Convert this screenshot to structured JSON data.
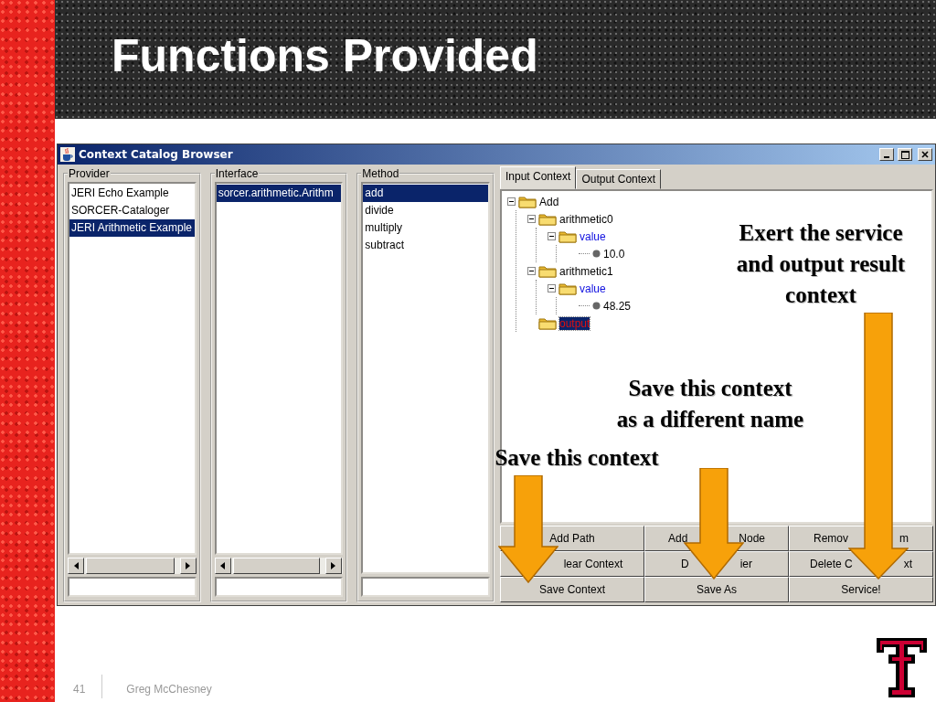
{
  "slide": {
    "title": "Functions Provided",
    "page_number": "41",
    "author": "Greg McChesney"
  },
  "window": {
    "title": "Context Catalog Browser"
  },
  "panels": [
    {
      "title": "Provider",
      "horizontal_scrollbar": true,
      "items": [
        {
          "label": "JERI Echo Example",
          "selected": false
        },
        {
          "label": "SORCER-Cataloger",
          "selected": false
        },
        {
          "label": "JERI Arithmetic Example",
          "selected": true
        }
      ]
    },
    {
      "title": "Interface",
      "horizontal_scrollbar": true,
      "items": [
        {
          "label": "sorcer.arithmetic.Arithm",
          "selected": true
        }
      ]
    },
    {
      "title": "Method",
      "horizontal_scrollbar": false,
      "items": [
        {
          "label": "add",
          "selected": true
        },
        {
          "label": "divide",
          "selected": false
        },
        {
          "label": "multiply",
          "selected": false
        },
        {
          "label": "subtract",
          "selected": false
        }
      ]
    }
  ],
  "tabs": [
    {
      "label": "Input Context",
      "selected": true
    },
    {
      "label": "Output Context",
      "selected": false
    }
  ],
  "tree": [
    {
      "label": "Add",
      "kind": "folder",
      "expanded": true,
      "selected": false,
      "children": [
        {
          "label": "arithmetic0",
          "kind": "folder",
          "expanded": true,
          "selected": false,
          "children": [
            {
              "label": "value",
              "kind": "path",
              "expanded": true,
              "selected": false,
              "children": [
                {
                  "label": "10.0",
                  "kind": "leaf",
                  "selected": false
                }
              ]
            }
          ]
        },
        {
          "label": "arithmetic1",
          "kind": "folder",
          "expanded": true,
          "selected": false,
          "children": [
            {
              "label": "value",
              "kind": "path",
              "expanded": true,
              "selected": false,
              "children": [
                {
                  "label": "48.25",
                  "kind": "leaf",
                  "selected": false
                }
              ]
            }
          ]
        },
        {
          "label": "output",
          "kind": "output",
          "selected": true
        }
      ]
    }
  ],
  "buttons": [
    {
      "parts": [
        "Add Path"
      ]
    },
    {
      "parts": [
        "Add",
        "Node"
      ]
    },
    {
      "parts": [
        "Remov",
        "m"
      ]
    },
    {
      "parts": [
        "lear Context"
      ]
    },
    {
      "parts": [
        "D",
        "ier"
      ]
    },
    {
      "parts": [
        "Delete C",
        "xt"
      ]
    },
    {
      "parts": [
        "Save Context"
      ]
    },
    {
      "parts": [
        "Save As"
      ]
    },
    {
      "parts": [
        "Service!"
      ]
    }
  ],
  "annotations": [
    {
      "text": "Exert the service\nand output result\ncontext"
    },
    {
      "text": "Save this context\nas a different name"
    },
    {
      "text": "Save this context"
    }
  ]
}
